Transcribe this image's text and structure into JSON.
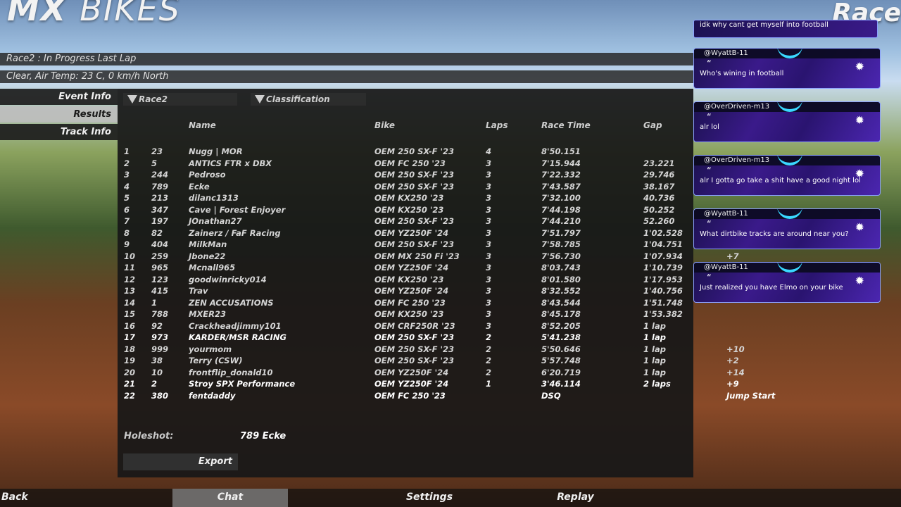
{
  "logo": {
    "bold": "MX",
    "thin": "BIKES"
  },
  "corner_logo": "Race",
  "status": {
    "line1": "Race2 : In Progress  Last Lap",
    "line2": "Clear, Air Temp: 23 C, 0 km/h North"
  },
  "side_nav": [
    {
      "label": "Event Info",
      "active": false
    },
    {
      "label": "Results",
      "active": true
    },
    {
      "label": "Track Info",
      "active": false
    }
  ],
  "dropdowns": {
    "race": "Race2",
    "view": "Classification"
  },
  "columns": {
    "name": "Name",
    "bike": "Bike",
    "laps": "Laps",
    "race_time": "Race Time",
    "gap": "Gap"
  },
  "results": [
    {
      "pos": "1",
      "num": "23",
      "name": "Nugg | MOR",
      "bike": "OEM 250 SX-F '23",
      "laps": "4",
      "time": "8'50.151",
      "gap": "",
      "pen": ""
    },
    {
      "pos": "2",
      "num": "5",
      "name": "ANTICS FTR x DBX",
      "bike": "OEM FC 250 '23",
      "laps": "3",
      "time": "7'15.944",
      "gap": "23.221",
      "pen": ""
    },
    {
      "pos": "3",
      "num": "244",
      "name": "Pedroso",
      "bike": "OEM 250 SX-F '23",
      "laps": "3",
      "time": "7'22.332",
      "gap": "29.746",
      "pen": ""
    },
    {
      "pos": "4",
      "num": "789",
      "name": "Ecke",
      "bike": "OEM 250 SX-F '23",
      "laps": "3",
      "time": "7'43.587",
      "gap": "38.167",
      "pen": ""
    },
    {
      "pos": "5",
      "num": "213",
      "name": "dilanc1313",
      "bike": "OEM KX250 '23",
      "laps": "3",
      "time": "7'32.100",
      "gap": "40.736",
      "pen": ""
    },
    {
      "pos": "6",
      "num": "347",
      "name": "Cave | Forest Enjoyer",
      "bike": "OEM KX250 '23",
      "laps": "3",
      "time": "7'44.198",
      "gap": "50.252",
      "pen": ""
    },
    {
      "pos": "7",
      "num": "197",
      "name": "JOnathan27",
      "bike": "OEM 250 SX-F '23",
      "laps": "3",
      "time": "7'44.210",
      "gap": "52.260",
      "pen": ""
    },
    {
      "pos": "8",
      "num": "82",
      "name": "Zainerz / FaF Racing",
      "bike": "OEM YZ250F '24",
      "laps": "3",
      "time": "7'51.797",
      "gap": "1'02.528",
      "pen": ""
    },
    {
      "pos": "9",
      "num": "404",
      "name": "MilkMan",
      "bike": "OEM 250 SX-F '23",
      "laps": "3",
      "time": "7'58.785",
      "gap": "1'04.751",
      "pen": ""
    },
    {
      "pos": "10",
      "num": "259",
      "name": "Jbone22",
      "bike": "OEM MX 250 Fi '23",
      "laps": "3",
      "time": "7'56.730",
      "gap": "1'07.934",
      "pen": "+7"
    },
    {
      "pos": "11",
      "num": "965",
      "name": "Mcnall965",
      "bike": "OEM YZ250F '24",
      "laps": "3",
      "time": "8'03.743",
      "gap": "1'10.739",
      "pen": ""
    },
    {
      "pos": "12",
      "num": "123",
      "name": "goodwinricky014",
      "bike": "OEM KX250 '23",
      "laps": "3",
      "time": "8'01.580",
      "gap": "1'17.953",
      "pen": ""
    },
    {
      "pos": "13",
      "num": "415",
      "name": "Trav",
      "bike": "OEM YZ250F '24",
      "laps": "3",
      "time": "8'32.552",
      "gap": "1'40.756",
      "pen": ""
    },
    {
      "pos": "14",
      "num": "1",
      "name": "ZEN ACCUSATIONS",
      "bike": "OEM FC 250 '23",
      "laps": "3",
      "time": "8'43.544",
      "gap": "1'51.748",
      "pen": ""
    },
    {
      "pos": "15",
      "num": "788",
      "name": "MXER23",
      "bike": "OEM KX250 '23",
      "laps": "3",
      "time": "8'45.178",
      "gap": "1'53.382",
      "pen": ""
    },
    {
      "pos": "16",
      "num": "92",
      "name": "Crackheadjimmy101",
      "bike": "OEM CRF250R '23",
      "laps": "3",
      "time": "8'52.205",
      "gap": "1 lap",
      "pen": ""
    },
    {
      "pos": "17",
      "num": "973",
      "name": "KARDER/MSR RACING",
      "bike": "OEM 250 SX-F '23",
      "laps": "2",
      "time": "5'41.238",
      "gap": "1 lap",
      "pen": "",
      "bright": true
    },
    {
      "pos": "18",
      "num": "999",
      "name": "yourmom",
      "bike": "OEM 250 SX-F '23",
      "laps": "2",
      "time": "5'50.646",
      "gap": "1 lap",
      "pen": "+10"
    },
    {
      "pos": "19",
      "num": "38",
      "name": "Terry (CSW)",
      "bike": "OEM 250 SX-F '23",
      "laps": "2",
      "time": "5'57.748",
      "gap": "1 lap",
      "pen": "+2"
    },
    {
      "pos": "20",
      "num": "10",
      "name": "frontflip_donald10",
      "bike": "OEM YZ250F '24",
      "laps": "2",
      "time": "6'20.719",
      "gap": "1 lap",
      "pen": "+14"
    },
    {
      "pos": "21",
      "num": "2",
      "name": "Stroy SPX Performance",
      "bike": "OEM YZ250F '24",
      "laps": "1",
      "time": "3'46.114",
      "gap": "2 laps",
      "pen": "+9",
      "bright": true
    },
    {
      "pos": "22",
      "num": "380",
      "name": "fentdaddy",
      "bike": "OEM FC 250 '23",
      "laps": "",
      "time": "DSQ",
      "gap": "",
      "pen": "Jump Start",
      "bright": true
    }
  ],
  "holeshot": {
    "label": "Holeshot:",
    "value": "789 Ecke"
  },
  "export_label": "Export",
  "bottom_nav": {
    "back": "Back",
    "chat": "Chat",
    "settings": "Settings",
    "replay": "Replay"
  },
  "chat": {
    "first_message": "idk why cant get myself into football",
    "messages": [
      {
        "user": "@WyattB-11",
        "text": "Who's wining in football"
      },
      {
        "user": "@OverDriven-m13",
        "text": "alr lol"
      },
      {
        "user": "@OverDriven-m13",
        "text": "alr I gotta go take a shit have a good night lol"
      },
      {
        "user": "@WyattB-11",
        "text": "What dirtbike tracks are around near you?"
      },
      {
        "user": "@WyattB-11",
        "text": "Just realized you have Elmo on your bike"
      }
    ]
  }
}
